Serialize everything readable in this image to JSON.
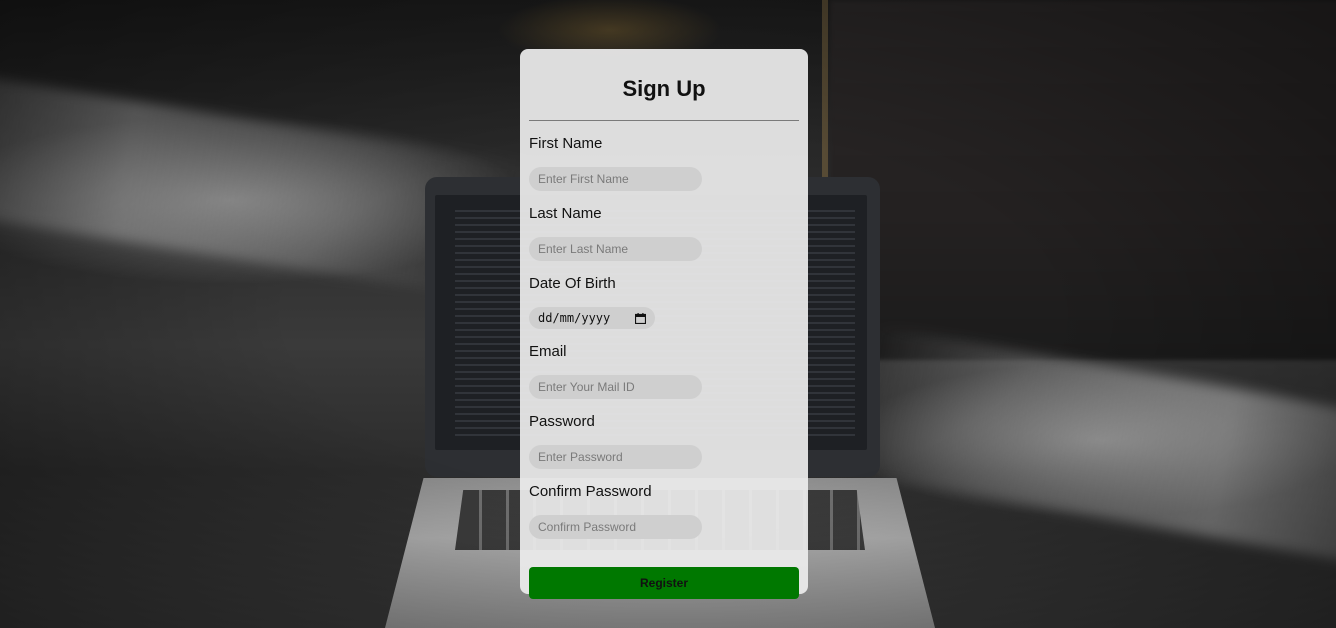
{
  "form": {
    "title": "Sign Up",
    "fields": [
      {
        "label": "First Name",
        "placeholder": "Enter First Name",
        "value": ""
      },
      {
        "label": "Last Name",
        "placeholder": "Enter Last Name",
        "value": ""
      },
      {
        "label": "Date Of Birth",
        "placeholder": "dd/mm/yyyy",
        "value": ""
      },
      {
        "label": "Email",
        "placeholder": "Enter Your Mail ID",
        "value": ""
      },
      {
        "label": "Password",
        "placeholder": "Enter Password",
        "value": ""
      },
      {
        "label": "Confirm Password",
        "placeholder": "Confirm Password",
        "value": ""
      }
    ],
    "date_icon": "calendar-icon",
    "submit_label": "Register"
  },
  "colors": {
    "card_background": "#ececec",
    "input_background": "#cfcfcf",
    "submit_button": "#007800"
  }
}
